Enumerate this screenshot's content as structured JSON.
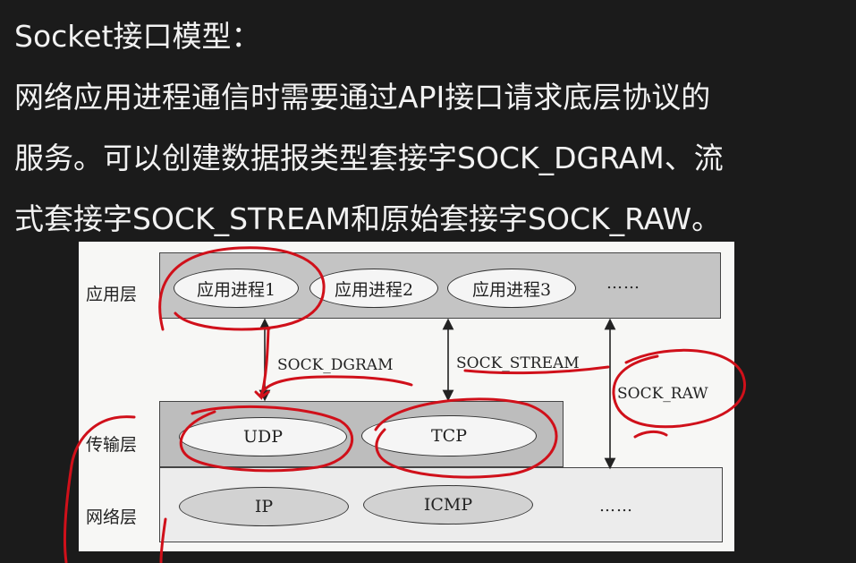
{
  "slide": {
    "title": "Socket接口模型：",
    "lines": [
      "网络应用进程通信时需要通过API接口请求底层协议的",
      "服务。可以创建数据报类型套接字SOCK_DGRAM、流",
      "式套接字SOCK_STREAM和原始套接字SOCK_RAW。"
    ]
  },
  "figure": {
    "layers": {
      "application": "应用层",
      "transport": "传输层",
      "network": "网络层"
    },
    "app_processes": [
      "应用进程1",
      "应用进程2",
      "应用进程3"
    ],
    "app_ellipsis": "……",
    "transport_protocols": [
      "UDP",
      "TCP"
    ],
    "network_protocols": [
      "IP",
      "ICMP"
    ],
    "network_ellipsis": "……",
    "socket_types": {
      "dgram": "SOCK_DGRAM",
      "stream": "SOCK_STREAM",
      "raw": "SOCK_RAW"
    }
  },
  "colors": {
    "slide_background": "#1b1b1b",
    "slide_text": "#f2f2f2",
    "annotation_red": "#d0101a"
  }
}
